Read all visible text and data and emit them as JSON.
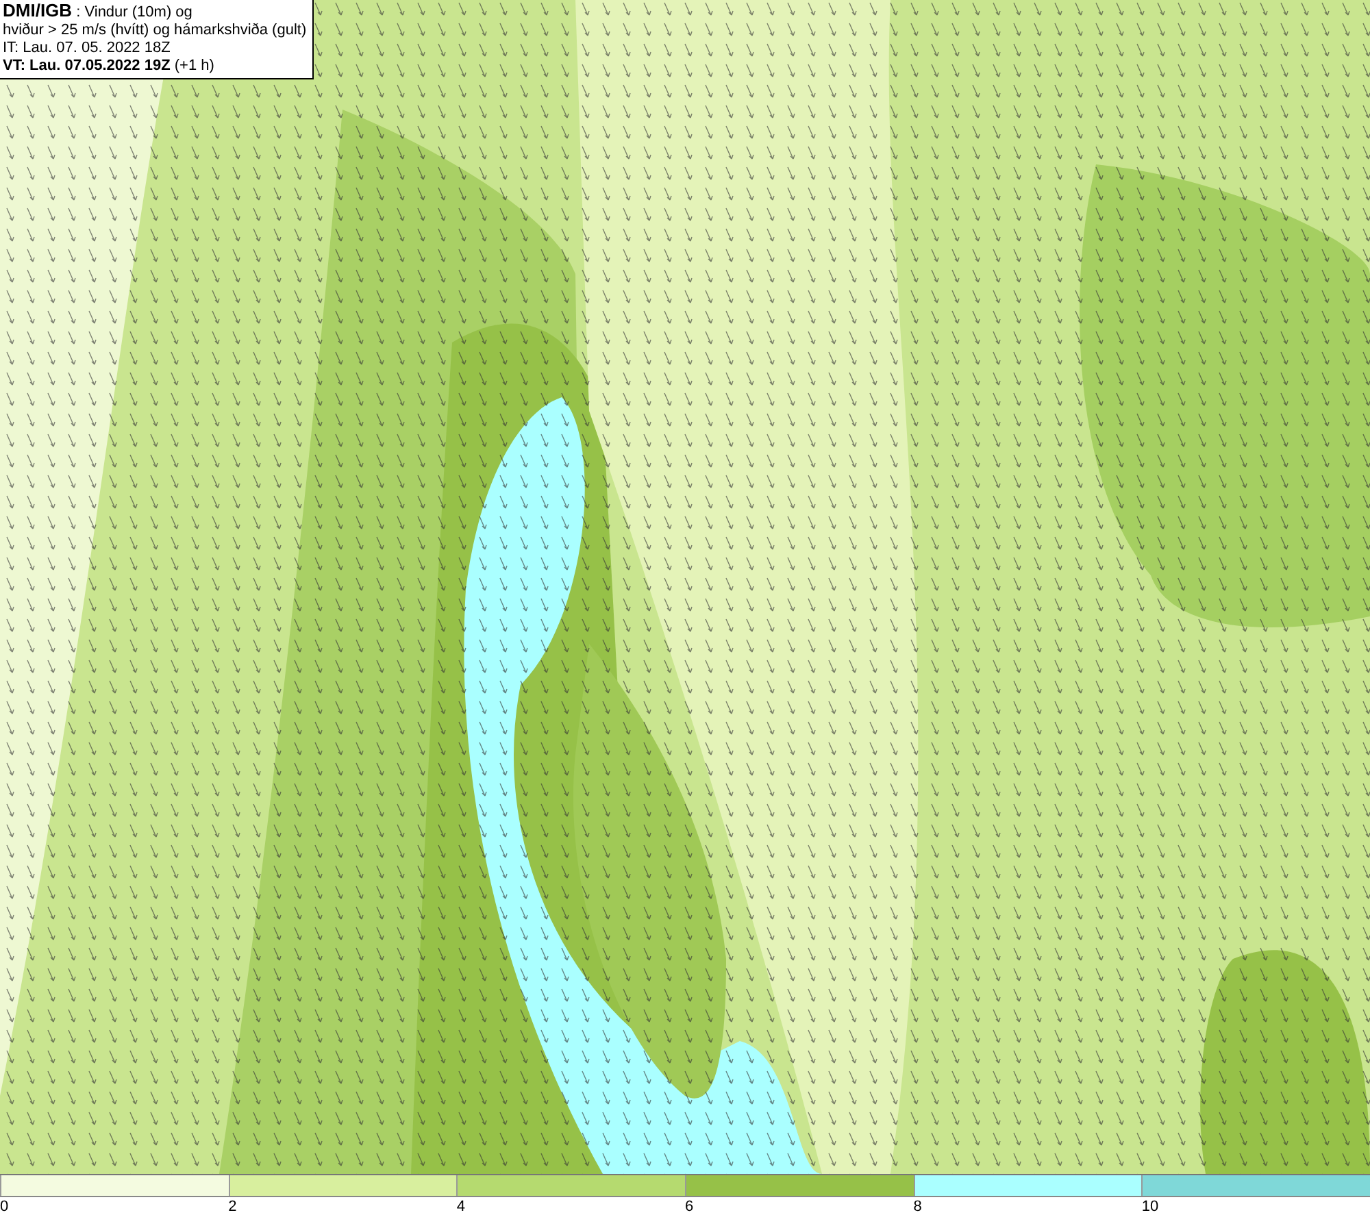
{
  "info_box": {
    "lines": [
      "**DMI/IGB** : Vindur (10m) og",
      "hviður > 25 m/s (hvítt) og hámarkshviða (gult)",
      "IT: Lau. 07. 05. 2022 18Z",
      "**VT: Lau. 07.05.2022 19Z** (+1 h)"
    ]
  },
  "legend": [
    {
      "label": "0",
      "color": "#f4fbe0"
    },
    {
      "label": "2",
      "color": "#d8ef9e"
    },
    {
      "label": "4",
      "color": "#b5da6f"
    },
    {
      "label": "6",
      "color": "#96c148"
    },
    {
      "label": "8",
      "color": "#aaffff"
    },
    {
      "label": "10",
      "color": "#7fd8d8"
    }
  ]
}
